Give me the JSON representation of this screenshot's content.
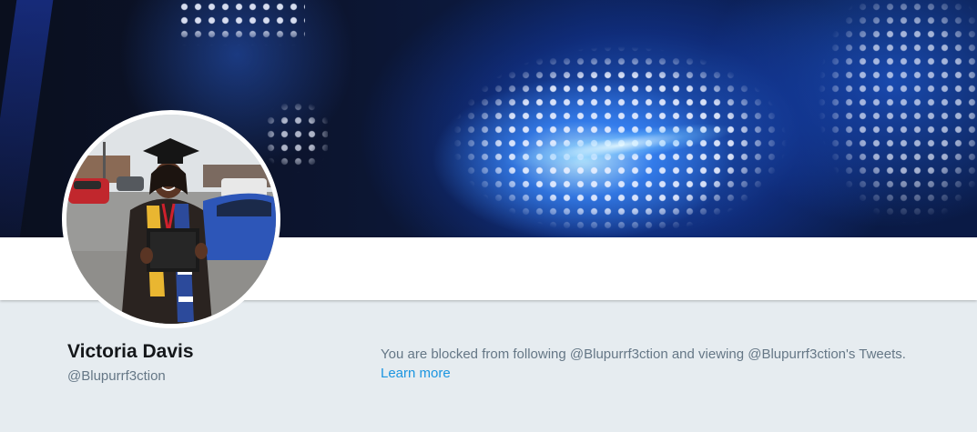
{
  "profile": {
    "display_name": "Victoria Davis",
    "handle": "@Blupurrf3ction"
  },
  "notice": {
    "blocked_text": "You are blocked from following @Blupurrf3ction and viewing @Blupurrf3ction's Tweets.",
    "learn_more": "Learn more"
  },
  "colors": {
    "page_background": "#e6ecf0",
    "link": "#1b95e0",
    "secondary_text": "#657786",
    "primary_text": "#14171a"
  }
}
